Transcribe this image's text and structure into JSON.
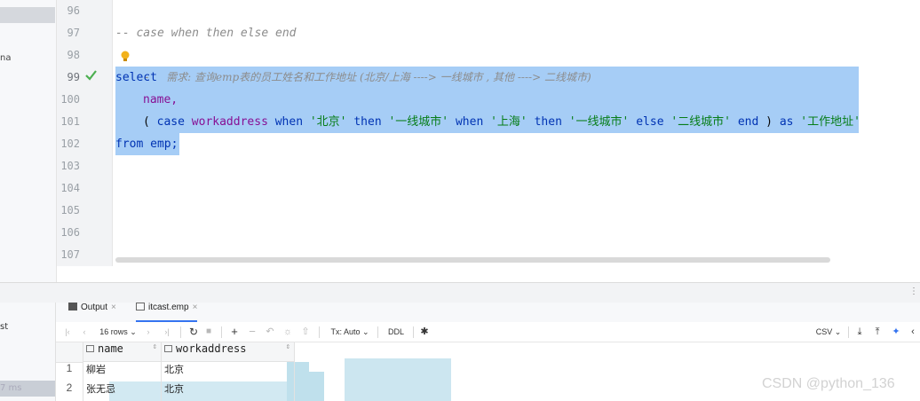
{
  "project": {
    "selected_fragment": "",
    "item_fragment": "na"
  },
  "gutter": {
    "line_numbers": [
      "96",
      "97",
      "98",
      "99",
      "100",
      "101",
      "102",
      "103",
      "104",
      "105",
      "106",
      "107"
    ],
    "current_line": "99"
  },
  "editor": {
    "comment_line": "-- case when then else end",
    "requirement_prefix": "-",
    "requirement_comment": "需求: 查询emp表的员工姓名和工作地址 (北京/上海 ----> 一线城市 , 其他 ----> 二线城市)",
    "line_select": "select",
    "line_name": "name,",
    "case_open_paren": "(",
    "kw_case": "case",
    "col_workaddress": "workaddress",
    "kw_when": "when",
    "str_beijing": "'北京'",
    "kw_then": "then",
    "str_tier1": "'一线城市'",
    "kw_when2": "when",
    "str_shanghai": "'上海'",
    "kw_then2": "then",
    "str_tier1_b": "'一线城市'",
    "kw_else": "else",
    "str_tier2": "'二线城市'",
    "kw_end": "end",
    "close_paren": ")",
    "kw_as": "as",
    "str_alias": "'工作地址'",
    "line_from": "from emp;"
  },
  "services": {
    "item_fragment": "st",
    "time_fragment": "7 ms"
  },
  "tabs": [
    {
      "label": "Output",
      "icon": "console-output-icon"
    },
    {
      "label": "itcast.emp",
      "icon": "table-icon"
    }
  ],
  "toolbar": {
    "rows_label": "16 rows",
    "tx_label": "Tx: Auto",
    "ddl_label": "DDL",
    "csv_label": "CSV"
  },
  "grid": {
    "columns": [
      "name",
      "workaddress"
    ],
    "rows": [
      {
        "num": "1",
        "name": "柳岩",
        "workaddress": "北京"
      },
      {
        "num": "2",
        "name": "张无忌",
        "workaddress": "北京"
      }
    ]
  },
  "watermark": "CSDN @python_136"
}
